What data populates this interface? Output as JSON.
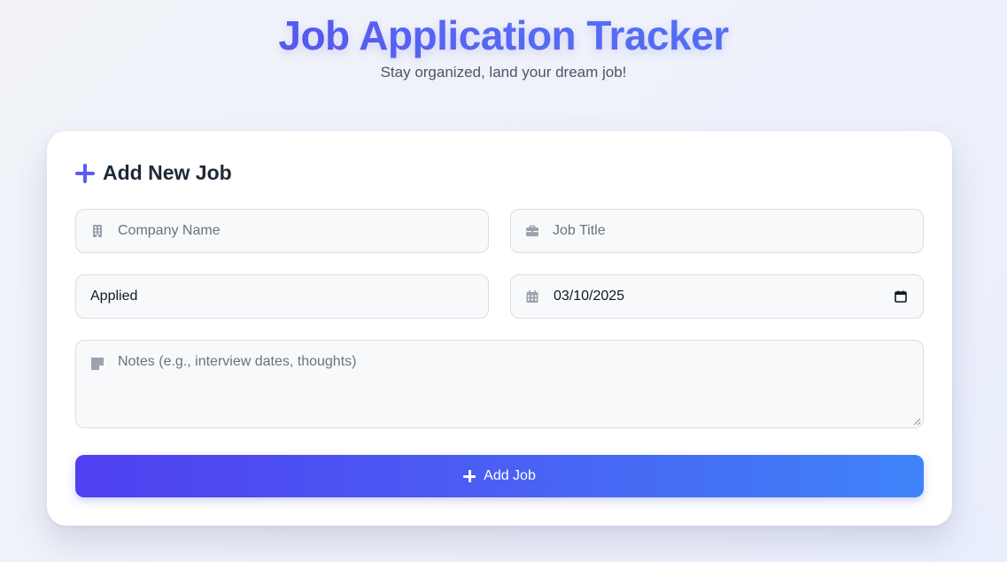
{
  "header": {
    "title": "Job Application Tracker",
    "subtitle": "Stay organized, land your dream job!"
  },
  "form": {
    "heading": "Add New Job",
    "heading_icon": "plus-icon",
    "company": {
      "placeholder": "Company Name",
      "value": "",
      "icon": "building-icon"
    },
    "job_title": {
      "placeholder": "Job Title",
      "value": "",
      "icon": "briefcase-icon"
    },
    "status": {
      "value": "Applied"
    },
    "date": {
      "value": "03/10/2025",
      "icon": "calendar-icon"
    },
    "notes": {
      "placeholder": "Notes (e.g., interview dates, thoughts)",
      "value": "",
      "icon": "sticky-note-icon"
    },
    "submit": {
      "label": "Add Job",
      "icon": "plus-icon"
    }
  },
  "colors": {
    "accent": "#5b5cf0",
    "button_start": "#4f3ff0",
    "button_end": "#3f83f8",
    "icon_gray": "#9ca3af"
  }
}
